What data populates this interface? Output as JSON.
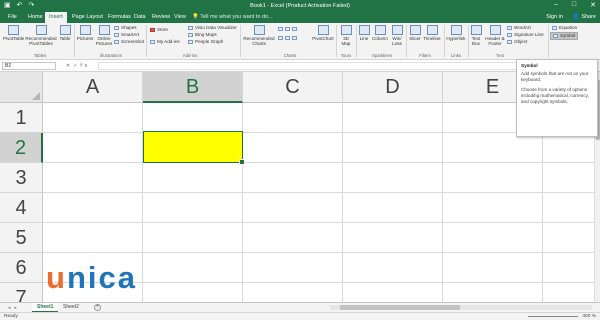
{
  "window": {
    "title": "Book1 - Excel (Product Activation Failed)",
    "qat_icons": [
      "save-icon",
      "undo-icon",
      "redo-icon"
    ],
    "controls": [
      "minimize",
      "maximize",
      "close"
    ]
  },
  "tabs": {
    "items": [
      "File",
      "Home",
      "Insert",
      "Page Layout",
      "Formulas",
      "Data",
      "Review",
      "View"
    ],
    "active": "Insert",
    "tell_me": "Tell me what you want to do...",
    "sign_in": "Sign in",
    "share": "Share"
  },
  "ribbon": {
    "tables": {
      "group": "Tables",
      "pivottable": "PivotTable",
      "recommended_pivottables": "Recommended PivotTables",
      "table": "Table"
    },
    "illustrations": {
      "group": "Illustrations",
      "pictures": "Pictures",
      "online_pictures": "Online Pictures",
      "shapes": "Shapes",
      "smartart": "SmartArt",
      "screenshot": "Screenshot"
    },
    "addins": {
      "group": "Add-ins",
      "store": "Store",
      "my_addins": "My Add-ins",
      "visio": "Visio Data Visualizer",
      "bing_maps": "Bing Maps",
      "people_graph": "People Graph"
    },
    "charts": {
      "group": "Charts",
      "recommended": "Recommended Charts",
      "pivotchart": "PivotChart"
    },
    "tours": {
      "group": "Tours",
      "map3d": "3D Map"
    },
    "sparklines": {
      "group": "Sparklines",
      "line": "Line",
      "column": "Column",
      "winloss": "Win/ Loss"
    },
    "filters": {
      "group": "Filters",
      "slicer": "Slicer",
      "timeline": "Timeline"
    },
    "links": {
      "group": "Links",
      "hyperlink": "Hyperlink"
    },
    "text": {
      "group": "Text",
      "textbox": "Text Box",
      "header_footer": "Header & Footer",
      "wordart": "WordArt",
      "signature_line": "Signature Line",
      "object": "Object"
    },
    "symbols": {
      "equation": "Equation",
      "symbol": "Symbol"
    }
  },
  "formula_bar": {
    "name_box": "B2",
    "fx": "fx",
    "value": ""
  },
  "grid": {
    "columns": [
      "A",
      "B",
      "C",
      "D",
      "E"
    ],
    "rows": [
      "1",
      "2",
      "3",
      "4",
      "5",
      "6",
      "7"
    ],
    "selected_cell": "B2",
    "selected_fill": "#ffff00"
  },
  "sheets": {
    "items": [
      "Sheet1",
      "Sheet2"
    ],
    "active": "Sheet1"
  },
  "status": {
    "ready": "Ready",
    "zoom": "400 %"
  },
  "tooltip": {
    "title": "Symbol",
    "line1": "Add symbols that are not on your keyboard.",
    "line2": "Choose from a variety of options including mathematical, currency, and copyright symbols."
  },
  "logo": {
    "text_u": "u",
    "text_rest": "nica"
  },
  "colors": {
    "excel_green": "#217346",
    "logo_blue": "#1f74bb",
    "logo_orange": "#ec6b2d"
  }
}
